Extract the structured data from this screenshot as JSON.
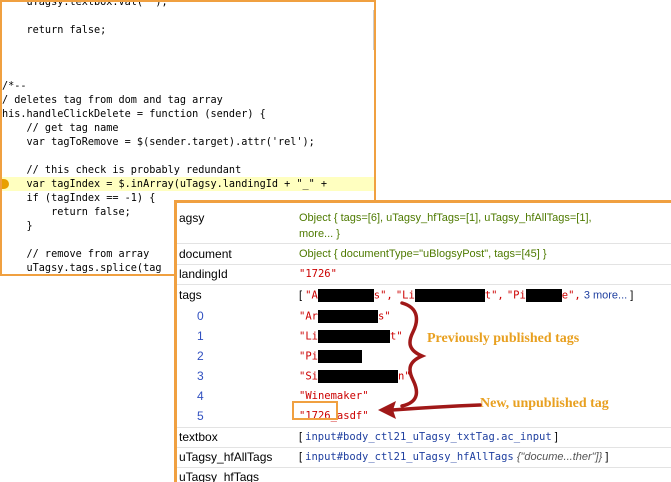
{
  "code_lines": [
    "    uTagsy.textbox.val('');",
    "",
    "    return false;",
    "",
    "",
    "",
    "/*--",
    "/ deletes tag from dom and tag array",
    "his.handleClickDelete = function (sender) {",
    "    // get tag name",
    "    var tagToRemove = $(sender.target).attr('rel');",
    "",
    "    // this check is probably redundant",
    "    var tagIndex = $.inArray(uTagsy.landingId + \"_\" +",
    "    if (tagIndex == -1) {",
    "        return false;",
    "    }",
    "",
    "    // remove from array",
    "    uTagsy.tags.splice(tag"
  ],
  "code_tick": "[",
  "watch": {
    "utagsy_name": "agsy",
    "utagsy_value_1": "Object {  tags=[6],   uTagsy_hfTags=[1],   uTagsy_hfAllTags=[1],",
    "utagsy_value_2": "more... }",
    "document_name": "document",
    "document_value": "Object {  documentType=\"uBlogsyPost\",   tags=[45] }",
    "landingid_name": "landingId",
    "landingid_value": "\"1726\"",
    "tags_name": "tags",
    "tags_open": "[",
    "tags_item1_a": "\"A",
    "tags_item1_b": "s\",",
    "tags_item2_a": "\"Li",
    "tags_item2_b": "t\",",
    "tags_item3_a": "\"Pi",
    "tags_item3_b": "e\",",
    "tags_more": "3 more...",
    "tags_close": "]",
    "items": [
      {
        "index": "0",
        "pre": "\"Ar",
        "post": "s\""
      },
      {
        "index": "1",
        "pre": "\"Li",
        "post": "t\""
      },
      {
        "index": "2",
        "pre": "\"Pi",
        "post": ""
      },
      {
        "index": "3",
        "pre": "\"Si",
        "post": "n\""
      },
      {
        "index": "4",
        "pre": "\"Winemaker\"",
        "post": ""
      },
      {
        "index": "5",
        "pre": "\"1726_asdf\"",
        "post": ""
      }
    ],
    "textbox_name": "textbox",
    "textbox_value_open": "[",
    "textbox_value": "input#body_ctl21_uTagsy_txtTag.ac_input",
    "textbox_value_close": "]",
    "hfall_name": "uTagsy_hfAllTags",
    "hfall_value_open": "[",
    "hfall_value": "input#body_ctl21_uTagsy_hfAllTags",
    "hfall_extra": "{\"docume...ther\"]}",
    "hfall_value_close": "]",
    "hftags_name": "uTagsy_hfTags"
  },
  "annotations": {
    "previous": "Previously published tags",
    "new_tag": "New, unpublished tag"
  },
  "colors": {
    "accent": "#f0a040",
    "annotation_text": "#e8a020",
    "arrow": "#a01818",
    "string_value": "#cc0000",
    "object_value": "#4e7a00",
    "index": "#3050c0"
  }
}
